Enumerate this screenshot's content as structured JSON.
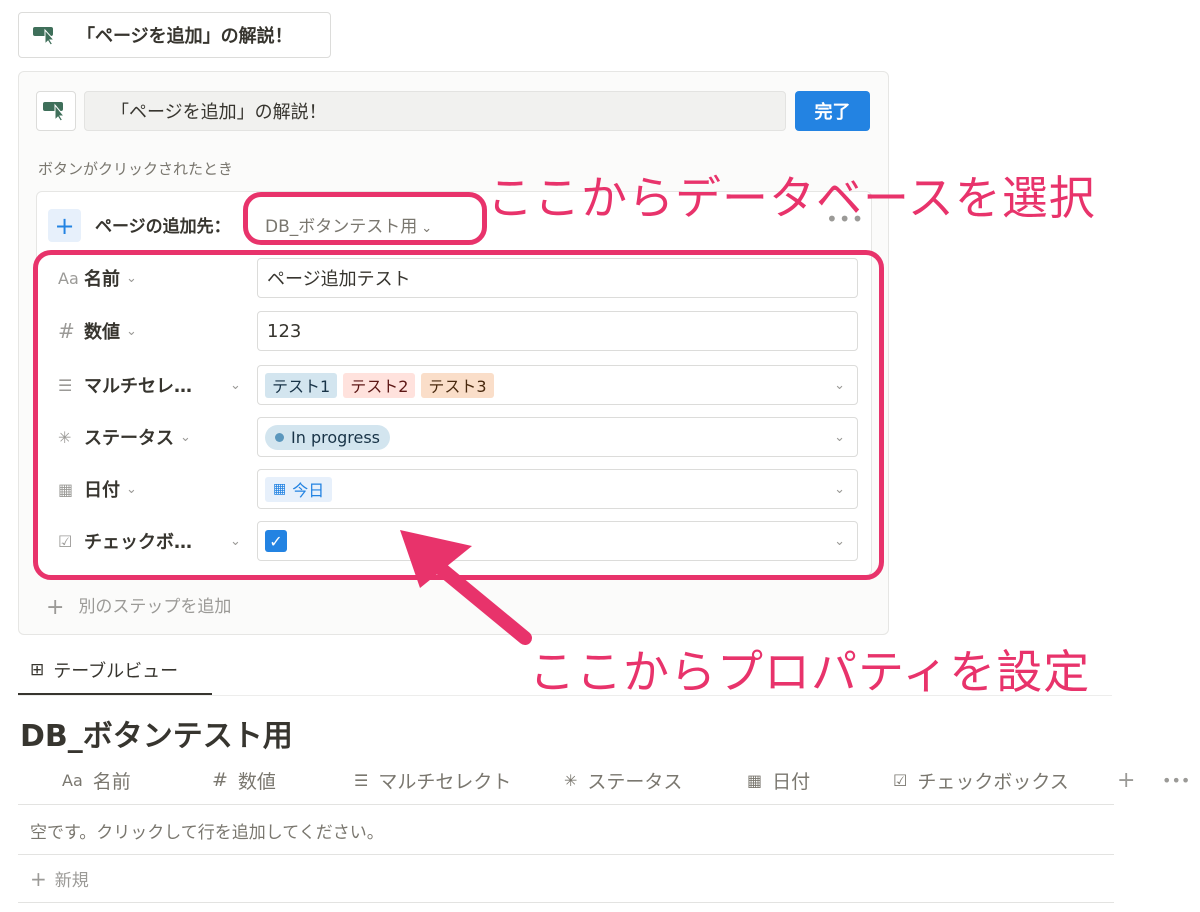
{
  "top_button": {
    "label": "「ページを追加」の解説！"
  },
  "editor": {
    "button_name": "「ページを追加」の解説！",
    "done_label": "完了",
    "trigger_label": "ボタンがクリックされたとき",
    "step": {
      "destination_label": "ページの追加先：",
      "destination_value": "DB_ボタンテスト用",
      "more": "•••"
    },
    "properties": [
      {
        "icon": "Aa",
        "icon_name": "text-icon",
        "name": "名前",
        "value": "ページ追加テスト"
      },
      {
        "icon": "#",
        "icon_name": "number-icon",
        "name": "数値",
        "value": "123"
      },
      {
        "icon": "☰",
        "icon_name": "multi-select-icon",
        "name": "マルチセレ…",
        "tags": [
          "テスト1",
          "テスト2",
          "テスト3"
        ]
      },
      {
        "icon": "✳",
        "icon_name": "status-icon",
        "name": "ステータス",
        "status": "In progress"
      },
      {
        "icon": "▦",
        "icon_name": "calendar-icon",
        "name": "日付",
        "date": "今日"
      },
      {
        "icon": "☑",
        "icon_name": "checkbox-icon",
        "name": "チェックボ…",
        "checked": true
      }
    ],
    "add_step_label": "別のステップを追加"
  },
  "annotations": {
    "select_db": "ここからデータベースを選択",
    "set_props": "ここからプロパティを設定",
    "color": "#e8336b"
  },
  "database": {
    "view_tab": "テーブルビュー",
    "title": "DB_ボタンテスト用",
    "columns": [
      {
        "icon": "Aa",
        "label": "名前"
      },
      {
        "icon": "#",
        "label": "数値"
      },
      {
        "icon": "☰",
        "label": "マルチセレクト"
      },
      {
        "icon": "✳",
        "label": "ステータス"
      },
      {
        "icon": "▦",
        "label": "日付"
      },
      {
        "icon": "☑",
        "label": "チェックボックス"
      }
    ],
    "add_column": "+",
    "more": "•••",
    "empty_text": "空です。クリックして行を追加してください。",
    "new_label": "新規"
  },
  "colors": {
    "accent": "#2383e2",
    "annotation": "#e8336b"
  }
}
